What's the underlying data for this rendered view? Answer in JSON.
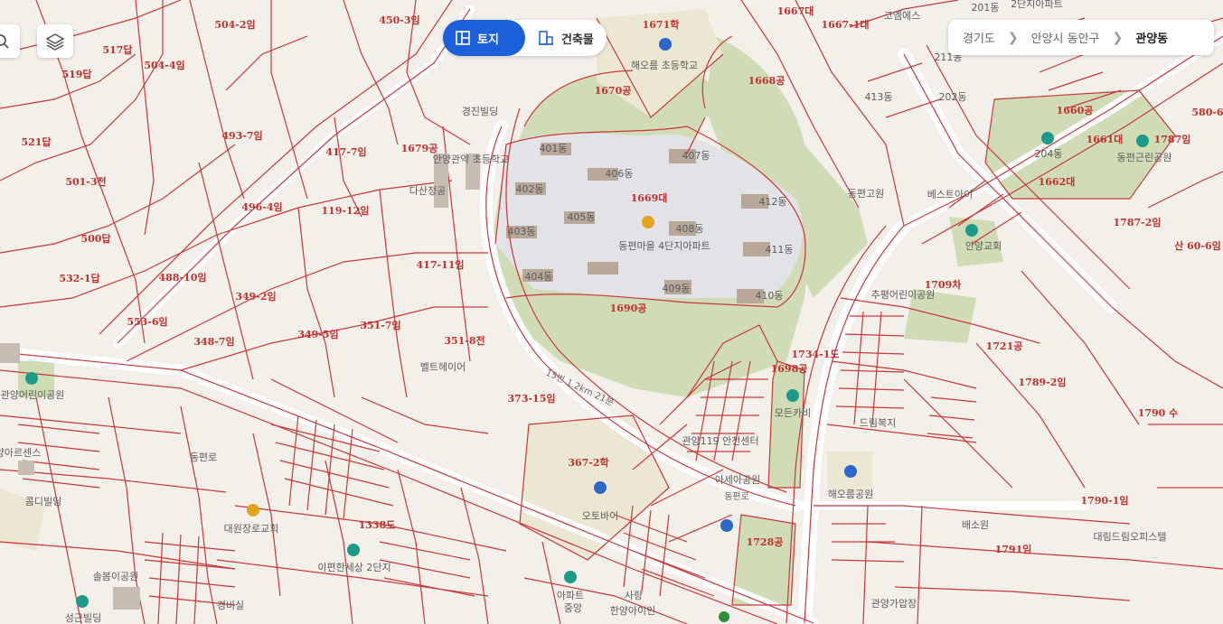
{
  "toolbar": {
    "search_icon": "search-icon",
    "layers_icon": "layers-icon"
  },
  "mode_toggle": {
    "land_label": "토지",
    "building_label": "건축물",
    "active": "land",
    "active_color": "#1b5fd9"
  },
  "breadcrumb": {
    "province": "경기도",
    "city": "안양시 동안구",
    "district": "관양동"
  },
  "map": {
    "parcel_color": "#c8373a",
    "park_color": "#cfdcb6",
    "parcel_labels": [
      "504-2임",
      "450-3임",
      "517답",
      "504-4임",
      "519답",
      "1671학",
      "1667대",
      "1667-1대",
      "493-7임",
      "521답",
      "417-7임",
      "1679공",
      "1670공",
      "1668공",
      "1660공",
      "580-6",
      "1661대",
      "1787임",
      "501-3전",
      "496-4임",
      "119-12임",
      "1669대",
      "1662대",
      "500답",
      "417-11임",
      "1787-2임",
      "산 60-6임",
      "532-1답",
      "488-10임",
      "349-2임",
      "1690공",
      "1709차",
      "553-6임",
      "351-7임",
      "349-5임",
      "348-7임",
      "351-8전",
      "1721공",
      "1734-1도",
      "1698공",
      "373-15임",
      "1789-2임",
      "1790 수",
      "367-2학",
      "1728공",
      "1790-1임",
      "1791임",
      "1338도"
    ],
    "place_labels": [
      "해오름 초등학교",
      "경진빌딩",
      "동편마을 4단지아파트",
      "401동",
      "402동",
      "403동",
      "404동",
      "405동",
      "406동",
      "407동",
      "408동",
      "409동",
      "410동",
      "411동",
      "412동",
      "413동",
      "코엠에스",
      "211동",
      "202동",
      "201동",
      "2단지아파트",
      "204동",
      "동편근린공원",
      "동편고원",
      "베스트아이",
      "안양교회",
      "추평어린이공원",
      "드림복지",
      "모든카비",
      "해오름공원",
      "관양119 안전센터",
      "오토바이",
      "안양관악 초등학교",
      "다산정공",
      "대원장로교회",
      "이편한세상 2단지",
      "솔봄이공원",
      "경비실",
      "성근빌딩",
      "관양어린이공원",
      "아파트",
      "중앙",
      "사랑",
      "한양아이인",
      "배소원",
      "대림드림오피스텔",
      "관양가압장",
      "콤디빌딩",
      "아세아공원",
      "동편로",
      "벨트헤이어",
      "관양아르센스",
      "한인회교회",
      "관양어린이공원"
    ],
    "road_labels": [
      "15번 1.2km 21분",
      "동편로"
    ]
  }
}
